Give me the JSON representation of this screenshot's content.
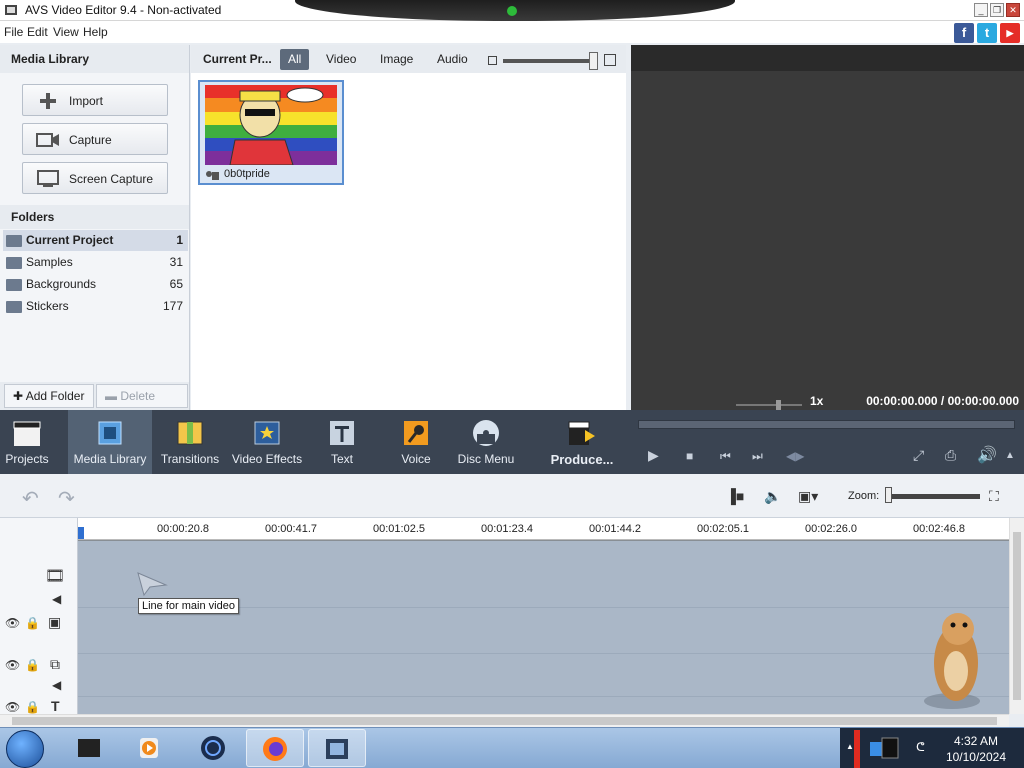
{
  "window": {
    "title": "AVS Video Editor 9.4 - Non-activated",
    "buttons": {
      "minimize": "_",
      "restore": "❐",
      "close": "✕"
    }
  },
  "menu": {
    "items": [
      "File",
      "Edit",
      "View",
      "Help"
    ]
  },
  "social": {
    "facebook": "f",
    "twitter": "t",
    "youtube": "▶"
  },
  "media_library": {
    "header": "Media Library",
    "buttons": {
      "import": "Import",
      "capture": "Capture",
      "screen_capture": "Screen Capture"
    },
    "folders_header": "Folders",
    "folders": [
      {
        "name": "Current Project",
        "count": "1"
      },
      {
        "name": "Samples",
        "count": "31"
      },
      {
        "name": "Backgrounds",
        "count": "65"
      },
      {
        "name": "Stickers",
        "count": "177"
      }
    ],
    "add_folder": "Add Folder",
    "delete_folder": "Delete Folder"
  },
  "content": {
    "header": "Current Pr...",
    "tabs": [
      "All",
      "Video",
      "Image",
      "Audio"
    ],
    "active_tab": "All",
    "items": [
      {
        "name": "0b0tpride"
      }
    ]
  },
  "preview": {
    "speed": "1x",
    "timecode": "00:00:00.000  /  00:00:00.000"
  },
  "toolbar": {
    "projects": "Projects",
    "media_library": "Media Library",
    "transitions": "Transitions",
    "video_effects": "Video Effects",
    "text": "Text",
    "voice": "Voice",
    "disc_menu": "Disc Menu",
    "produce": "Produce..."
  },
  "timeline": {
    "zoom_label": "Zoom:",
    "ticks": [
      "00:00:20.8",
      "00:00:41.7",
      "00:01:02.5",
      "00:01:23.4",
      "00:01:44.2",
      "00:02:05.1",
      "00:02:26.0",
      "00:02:46.8"
    ],
    "tooltip": "Line for main video"
  },
  "taskbar": {
    "time": "4:32 AM",
    "date": "10/10/2024"
  },
  "colors": {
    "toolbar_bg": "#3a4452",
    "active_tool": "#536274",
    "timeline_bg": "#aab7c7",
    "accent": "#5a8ed0"
  }
}
